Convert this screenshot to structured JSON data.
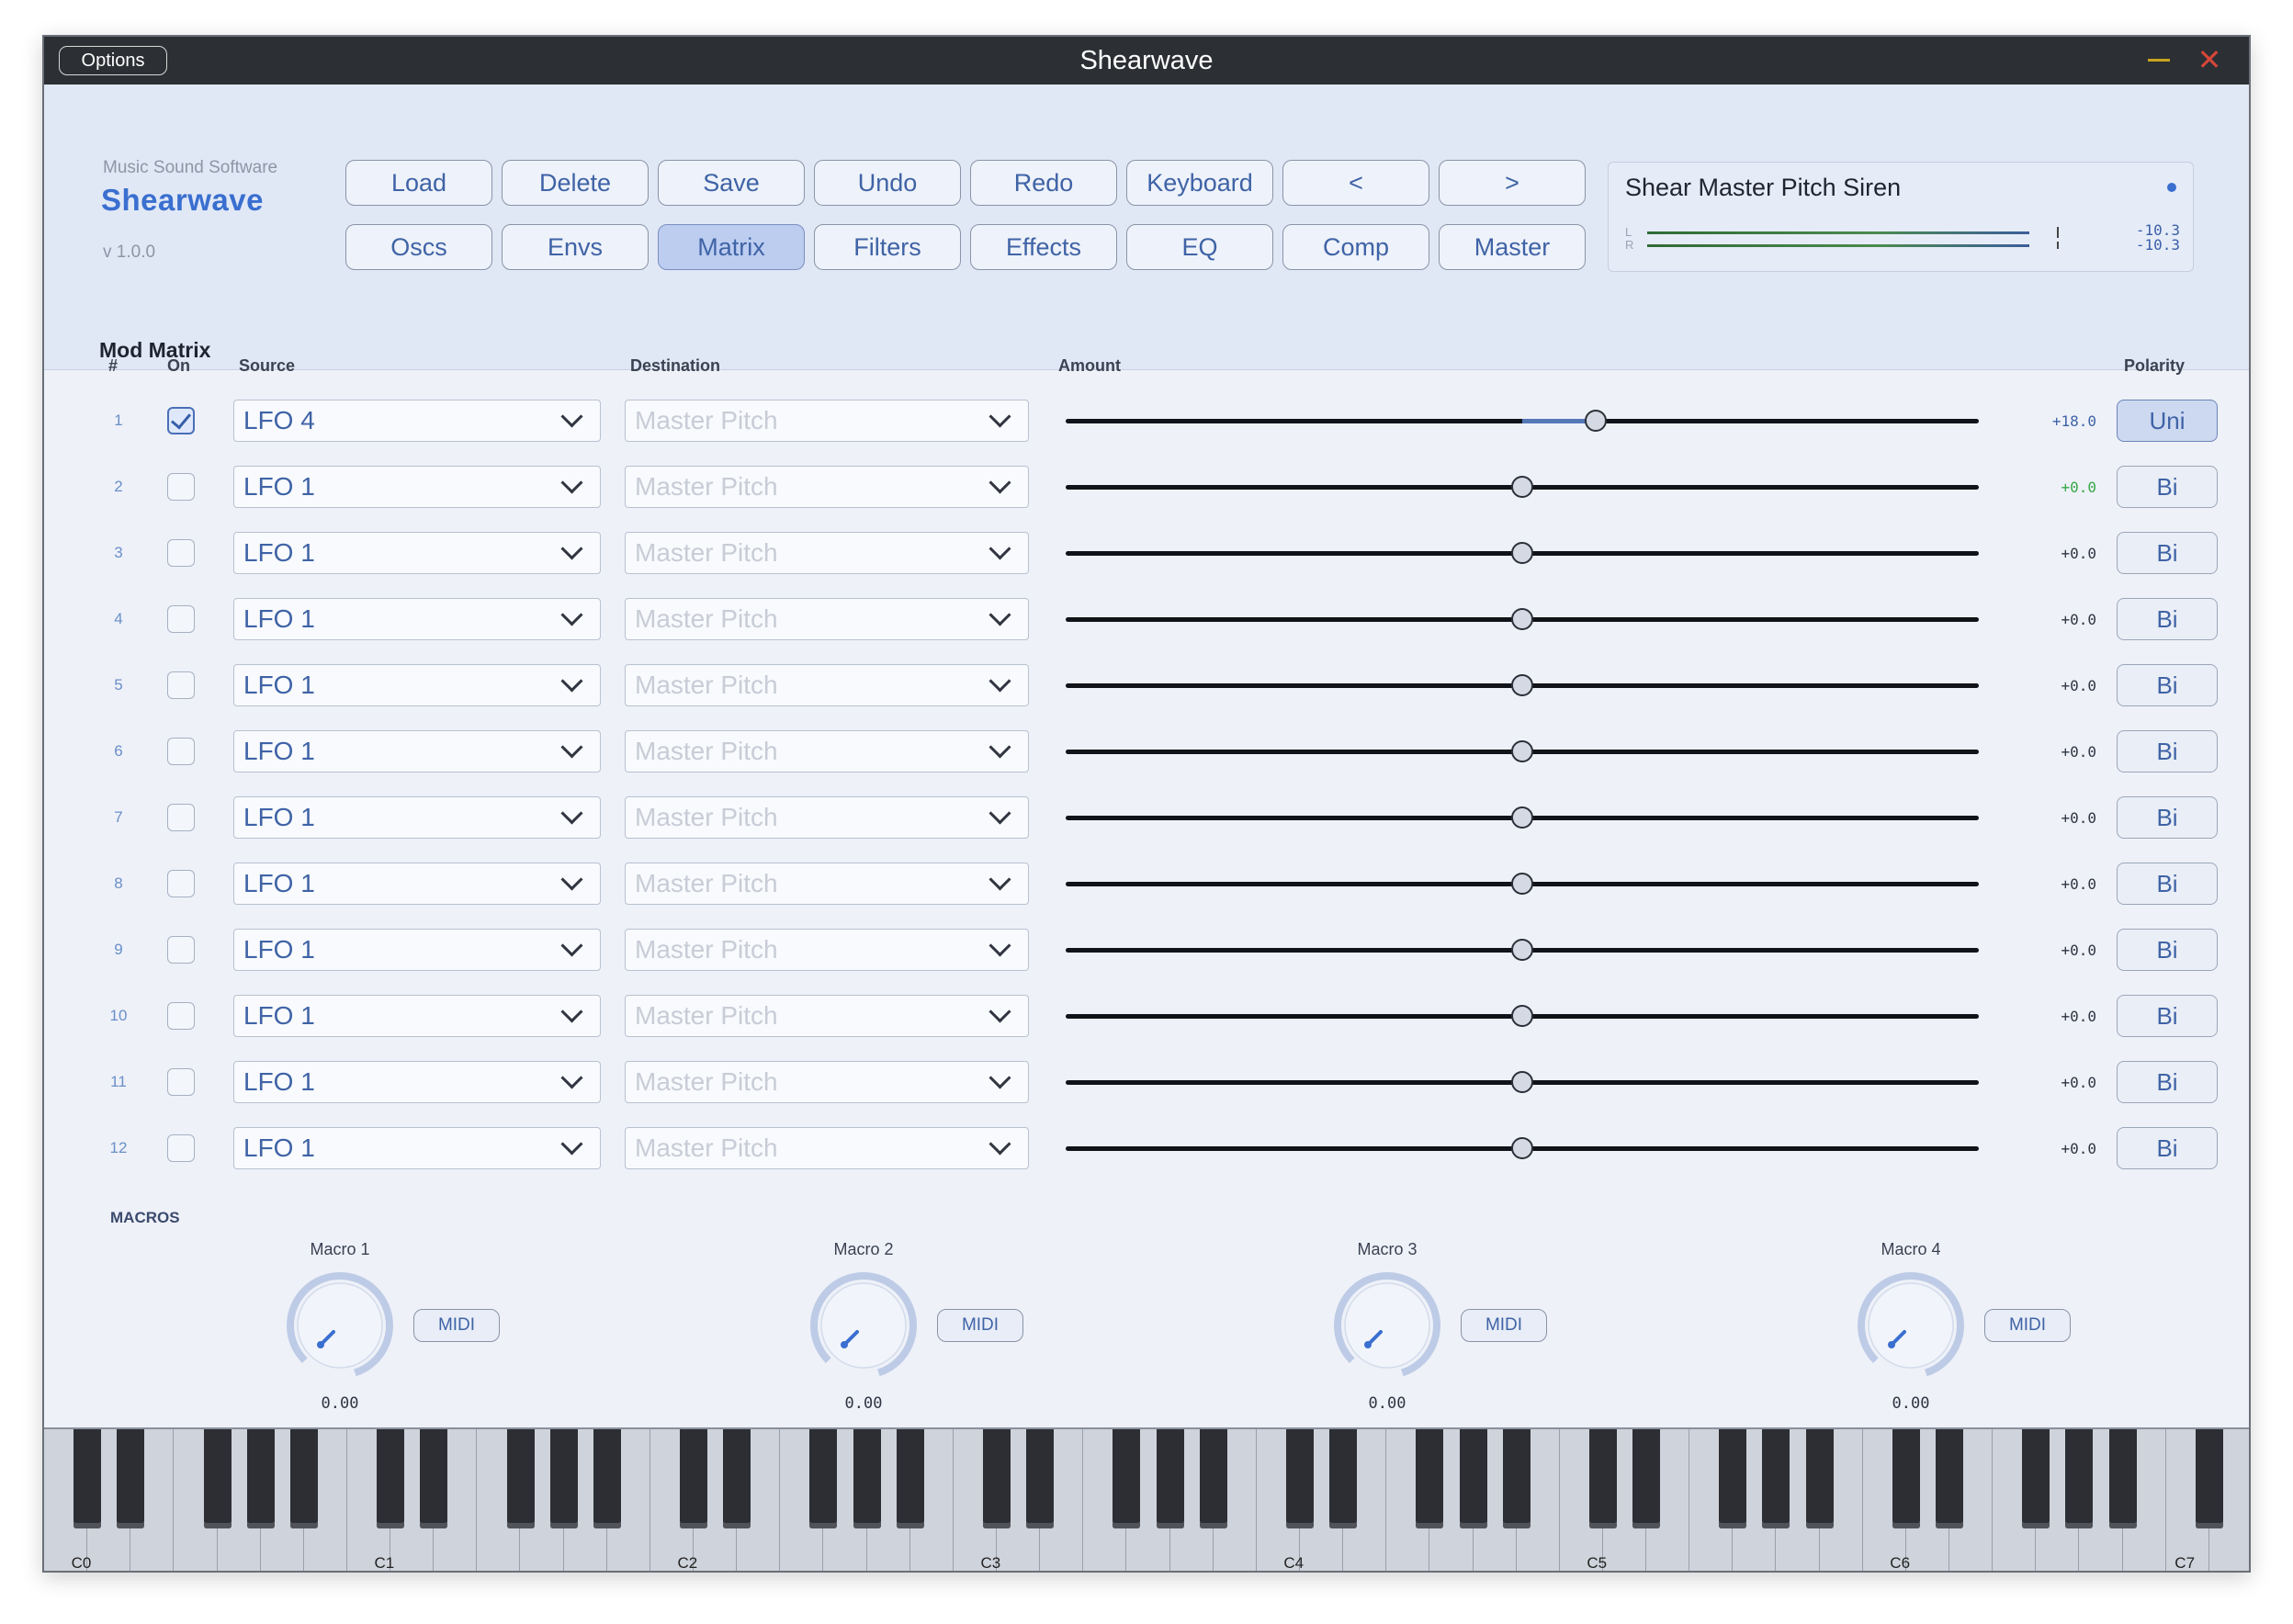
{
  "window": {
    "title": "Shearwave",
    "options_label": "Options",
    "minimize_icon": "minimize-icon",
    "close_icon": "close-icon"
  },
  "brand": {
    "company": "Music Sound Software",
    "name": "Shearwave",
    "version": "v 1.0.0"
  },
  "toolbar": {
    "row1": [
      "Load",
      "Delete",
      "Save",
      "Undo",
      "Redo",
      "Keyboard",
      "<",
      ">"
    ],
    "row2": [
      "Oscs",
      "Envs",
      "Matrix",
      "Filters",
      "Effects",
      "EQ",
      "Comp",
      "Master"
    ],
    "active_tab": "Matrix"
  },
  "preset": {
    "name": "Shear Master Pitch Siren",
    "meter_left_label": "L",
    "meter_right_label": "R",
    "meter_left_value": "-10.3",
    "meter_right_value": "-10.3"
  },
  "section_title": "Mod Matrix",
  "table": {
    "headers": {
      "num": "#",
      "on": "On",
      "source": "Source",
      "destination": "Destination",
      "amount": "Amount",
      "polarity": "Polarity"
    },
    "rows": [
      {
        "num": "1",
        "on": true,
        "source": "LFO 4",
        "destination": "Master Pitch",
        "amount": 0.58,
        "amount_label": "+18.0",
        "polarity": "Uni"
      },
      {
        "num": "2",
        "on": false,
        "source": "LFO 1",
        "destination": "Master Pitch",
        "amount": 0.5,
        "amount_label": "+0.0",
        "polarity": "Bi"
      },
      {
        "num": "3",
        "on": false,
        "source": "LFO 1",
        "destination": "Master Pitch",
        "amount": 0.5,
        "amount_label": "+0.0",
        "polarity": "Bi"
      },
      {
        "num": "4",
        "on": false,
        "source": "LFO 1",
        "destination": "Master Pitch",
        "amount": 0.5,
        "amount_label": "+0.0",
        "polarity": "Bi"
      },
      {
        "num": "5",
        "on": false,
        "source": "LFO 1",
        "destination": "Master Pitch",
        "amount": 0.5,
        "amount_label": "+0.0",
        "polarity": "Bi"
      },
      {
        "num": "6",
        "on": false,
        "source": "LFO 1",
        "destination": "Master Pitch",
        "amount": 0.5,
        "amount_label": "+0.0",
        "polarity": "Bi"
      },
      {
        "num": "7",
        "on": false,
        "source": "LFO 1",
        "destination": "Master Pitch",
        "amount": 0.5,
        "amount_label": "+0.0",
        "polarity": "Bi"
      },
      {
        "num": "8",
        "on": false,
        "source": "LFO 1",
        "destination": "Master Pitch",
        "amount": 0.5,
        "amount_label": "+0.0",
        "polarity": "Bi"
      },
      {
        "num": "9",
        "on": false,
        "source": "LFO 1",
        "destination": "Master Pitch",
        "amount": 0.5,
        "amount_label": "+0.0",
        "polarity": "Bi"
      },
      {
        "num": "10",
        "on": false,
        "source": "LFO 1",
        "destination": "Master Pitch",
        "amount": 0.5,
        "amount_label": "+0.0",
        "polarity": "Bi"
      },
      {
        "num": "11",
        "on": false,
        "source": "LFO 1",
        "destination": "Master Pitch",
        "amount": 0.5,
        "amount_label": "+0.0",
        "polarity": "Bi"
      },
      {
        "num": "12",
        "on": false,
        "source": "LFO 1",
        "destination": "Master Pitch",
        "amount": 0.5,
        "amount_label": "+0.0",
        "polarity": "Bi"
      }
    ],
    "highlight_amount_row": 2,
    "highlight_color": "#3aa84a"
  },
  "macros": {
    "section_label": "MACROS",
    "items": [
      {
        "label": "Macro 1",
        "value": "0.00",
        "midi_label": "MIDI"
      },
      {
        "label": "Macro 2",
        "value": "0.00",
        "midi_label": "MIDI"
      },
      {
        "label": "Macro 3",
        "value": "0.00",
        "midi_label": "MIDI"
      },
      {
        "label": "Macro 4",
        "value": "0.00",
        "midi_label": "MIDI"
      }
    ]
  },
  "keyboard": {
    "octave_labels": [
      "C0",
      "C1",
      "C2",
      "C3",
      "C4",
      "C5",
      "C6",
      "C7"
    ]
  },
  "colors": {
    "accent": "#3a6fd0",
    "button_text": "#3f63a6",
    "titlebar": "#2c2f33",
    "close": "#d6463a",
    "minimize": "#c8a520"
  }
}
